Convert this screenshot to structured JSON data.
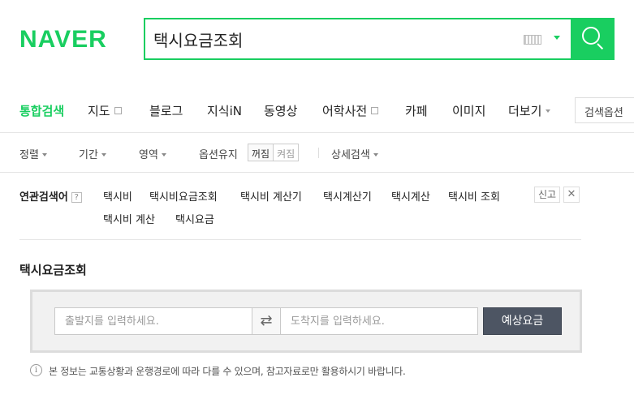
{
  "header": {
    "logo": "NAVER",
    "search_query": "택시요금조회",
    "brand_color": "#19ce60"
  },
  "tabs": [
    {
      "label": "통합검색",
      "active": true
    },
    {
      "label": "지도",
      "icon": "box-icon"
    },
    {
      "label": "블로그"
    },
    {
      "label": "지식iN"
    },
    {
      "label": "동영상"
    },
    {
      "label": "어학사전",
      "icon": "box-icon"
    },
    {
      "label": "카페"
    },
    {
      "label": "이미지"
    },
    {
      "label": "더보기",
      "icon": "caret-down-icon"
    }
  ],
  "tab_options_label": "검색옵션",
  "filters": {
    "sort": "정렬",
    "period": "기간",
    "area": "영역",
    "option_keep": "옵션유지",
    "off": "꺼짐",
    "on": "켜짐",
    "detail": "상세검색"
  },
  "related": {
    "title": "연관검색어",
    "help": "?",
    "items": [
      "택시비",
      "택시비요금조회",
      "택시비 계산기",
      "택시계산기",
      "택시계산",
      "택시비 조회",
      "택시비 계산",
      "택시요금"
    ],
    "report": "신고",
    "close": "✕"
  },
  "taxi": {
    "title": "택시요금조회",
    "origin_placeholder": "출발지를 입력하세요.",
    "dest_placeholder": "도착지를 입력하세요.",
    "swap_icon": "swap-arrows-icon",
    "estimate_label": "예상요금",
    "info": "본 정보는 교통상황과 운행경로에 따라 다를 수 있으며, 참고자료로만 활용하시기 바랍니다."
  }
}
